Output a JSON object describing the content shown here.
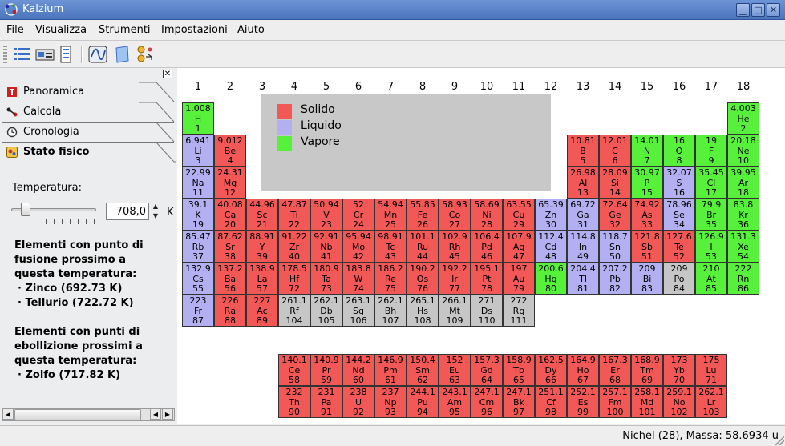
{
  "window": {
    "title": "Kalzium"
  },
  "menu": [
    "File",
    "Visualizza",
    "Strumenti",
    "Impostazioni",
    "Aiuto"
  ],
  "toolbar": {
    "icons": [
      "table-view-icon",
      "legend-icon",
      "element-list-icon",
      "plot-icon",
      "glossary-icon",
      "molecule-icon"
    ]
  },
  "sidebar": {
    "tabs": [
      {
        "label": "Panoramica",
        "icon": "overview-icon"
      },
      {
        "label": "Calcola",
        "icon": "calculator-icon"
      },
      {
        "label": "Cronologia",
        "icon": "clock-icon"
      },
      {
        "label": "Stato fisico",
        "icon": "state-of-matter-icon"
      }
    ],
    "temperature_label": "Temperatura:",
    "temperature_value": "708,0",
    "temperature_unit": "K",
    "slider_fraction": 0.13,
    "melting_heading": "Elementi con punto di fusione prossimo a questa temperatura:",
    "melting_elements": [
      "· Zinco (692.73 K)",
      "· Tellurio (722.72 K)"
    ],
    "boiling_heading": "Elementi con punti di ebollizione prossimi a questa temperatura:",
    "boiling_elements": [
      "· Zolfo (717.82 K)"
    ]
  },
  "groups": [
    "1",
    "2",
    "3",
    "4",
    "5",
    "6",
    "7",
    "8",
    "9",
    "10",
    "11",
    "12",
    "13",
    "14",
    "15",
    "16",
    "17",
    "18"
  ],
  "legend": [
    {
      "label": "Solido",
      "color": "#f25856"
    },
    {
      "label": "Liquido",
      "color": "#b3b0f1"
    },
    {
      "label": "Vapore",
      "color": "#57f13b"
    }
  ],
  "colors": {
    "solid": "#f25856",
    "liquid": "#b3b0f1",
    "vapor": "#57f13b",
    "unknown": "#c6c6c6"
  },
  "elements": [
    {
      "m": "1.008",
      "s": "H",
      "n": "1",
      "st": "vapor",
      "g": 1,
      "p": 1
    },
    {
      "m": "4.003",
      "s": "He",
      "n": "2",
      "st": "vapor",
      "g": 18,
      "p": 1
    },
    {
      "m": "6.941",
      "s": "Li",
      "n": "3",
      "st": "liquid",
      "g": 1,
      "p": 2
    },
    {
      "m": "9.012",
      "s": "Be",
      "n": "4",
      "st": "solid",
      "g": 2,
      "p": 2
    },
    {
      "m": "10.81",
      "s": "B",
      "n": "5",
      "st": "solid",
      "g": 13,
      "p": 2
    },
    {
      "m": "12.01",
      "s": "C",
      "n": "6",
      "st": "solid",
      "g": 14,
      "p": 2
    },
    {
      "m": "14.01",
      "s": "N",
      "n": "7",
      "st": "vapor",
      "g": 15,
      "p": 2
    },
    {
      "m": "16",
      "s": "O",
      "n": "8",
      "st": "vapor",
      "g": 16,
      "p": 2
    },
    {
      "m": "19",
      "s": "F",
      "n": "9",
      "st": "vapor",
      "g": 17,
      "p": 2
    },
    {
      "m": "20.18",
      "s": "Ne",
      "n": "10",
      "st": "vapor",
      "g": 18,
      "p": 2
    },
    {
      "m": "22.99",
      "s": "Na",
      "n": "11",
      "st": "liquid",
      "g": 1,
      "p": 3
    },
    {
      "m": "24.31",
      "s": "Mg",
      "n": "12",
      "st": "solid",
      "g": 2,
      "p": 3
    },
    {
      "m": "26.98",
      "s": "Al",
      "n": "13",
      "st": "solid",
      "g": 13,
      "p": 3
    },
    {
      "m": "28.09",
      "s": "Si",
      "n": "14",
      "st": "solid",
      "g": 14,
      "p": 3
    },
    {
      "m": "30.97",
      "s": "P",
      "n": "15",
      "st": "vapor",
      "g": 15,
      "p": 3
    },
    {
      "m": "32.07",
      "s": "S",
      "n": "16",
      "st": "liquid",
      "g": 16,
      "p": 3
    },
    {
      "m": "35.45",
      "s": "Cl",
      "n": "17",
      "st": "vapor",
      "g": 17,
      "p": 3
    },
    {
      "m": "39.95",
      "s": "Ar",
      "n": "18",
      "st": "vapor",
      "g": 18,
      "p": 3
    },
    {
      "m": "39.1",
      "s": "K",
      "n": "19",
      "st": "liquid",
      "g": 1,
      "p": 4
    },
    {
      "m": "40.08",
      "s": "Ca",
      "n": "20",
      "st": "solid",
      "g": 2,
      "p": 4
    },
    {
      "m": "44.96",
      "s": "Sc",
      "n": "21",
      "st": "solid",
      "g": 3,
      "p": 4
    },
    {
      "m": "47.87",
      "s": "Ti",
      "n": "22",
      "st": "solid",
      "g": 4,
      "p": 4
    },
    {
      "m": "50.94",
      "s": "V",
      "n": "23",
      "st": "solid",
      "g": 5,
      "p": 4
    },
    {
      "m": "52",
      "s": "Cr",
      "n": "24",
      "st": "solid",
      "g": 6,
      "p": 4
    },
    {
      "m": "54.94",
      "s": "Mn",
      "n": "25",
      "st": "solid",
      "g": 7,
      "p": 4
    },
    {
      "m": "55.85",
      "s": "Fe",
      "n": "26",
      "st": "solid",
      "g": 8,
      "p": 4
    },
    {
      "m": "58.93",
      "s": "Co",
      "n": "27",
      "st": "solid",
      "g": 9,
      "p": 4
    },
    {
      "m": "58.69",
      "s": "Ni",
      "n": "28",
      "st": "solid",
      "g": 10,
      "p": 4
    },
    {
      "m": "63.55",
      "s": "Cu",
      "n": "29",
      "st": "solid",
      "g": 11,
      "p": 4
    },
    {
      "m": "65.39",
      "s": "Zn",
      "n": "30",
      "st": "liquid",
      "g": 12,
      "p": 4
    },
    {
      "m": "69.72",
      "s": "Ga",
      "n": "31",
      "st": "liquid",
      "g": 13,
      "p": 4
    },
    {
      "m": "72.64",
      "s": "Ge",
      "n": "32",
      "st": "solid",
      "g": 14,
      "p": 4
    },
    {
      "m": "74.92",
      "s": "As",
      "n": "33",
      "st": "solid",
      "g": 15,
      "p": 4
    },
    {
      "m": "78.96",
      "s": "Se",
      "n": "34",
      "st": "liquid",
      "g": 16,
      "p": 4
    },
    {
      "m": "79.9",
      "s": "Br",
      "n": "35",
      "st": "vapor",
      "g": 17,
      "p": 4
    },
    {
      "m": "83.8",
      "s": "Kr",
      "n": "36",
      "st": "vapor",
      "g": 18,
      "p": 4
    },
    {
      "m": "85.47",
      "s": "Rb",
      "n": "37",
      "st": "liquid",
      "g": 1,
      "p": 5
    },
    {
      "m": "87.62",
      "s": "Sr",
      "n": "38",
      "st": "solid",
      "g": 2,
      "p": 5
    },
    {
      "m": "88.91",
      "s": "Y",
      "n": "39",
      "st": "solid",
      "g": 3,
      "p": 5
    },
    {
      "m": "91.22",
      "s": "Zr",
      "n": "40",
      "st": "solid",
      "g": 4,
      "p": 5
    },
    {
      "m": "92.91",
      "s": "Nb",
      "n": "41",
      "st": "solid",
      "g": 5,
      "p": 5
    },
    {
      "m": "95.94",
      "s": "Mo",
      "n": "42",
      "st": "solid",
      "g": 6,
      "p": 5
    },
    {
      "m": "98.91",
      "s": "Tc",
      "n": "43",
      "st": "solid",
      "g": 7,
      "p": 5
    },
    {
      "m": "101.1",
      "s": "Ru",
      "n": "44",
      "st": "solid",
      "g": 8,
      "p": 5
    },
    {
      "m": "102.9",
      "s": "Rh",
      "n": "45",
      "st": "solid",
      "g": 9,
      "p": 5
    },
    {
      "m": "106.4",
      "s": "Pd",
      "n": "46",
      "st": "solid",
      "g": 10,
      "p": 5
    },
    {
      "m": "107.9",
      "s": "Ag",
      "n": "47",
      "st": "solid",
      "g": 11,
      "p": 5
    },
    {
      "m": "112.4",
      "s": "Cd",
      "n": "48",
      "st": "liquid",
      "g": 12,
      "p": 5
    },
    {
      "m": "114.8",
      "s": "In",
      "n": "49",
      "st": "liquid",
      "g": 13,
      "p": 5
    },
    {
      "m": "118.7",
      "s": "Sn",
      "n": "50",
      "st": "liquid",
      "g": 14,
      "p": 5
    },
    {
      "m": "121.8",
      "s": "Sb",
      "n": "51",
      "st": "solid",
      "g": 15,
      "p": 5
    },
    {
      "m": "127.6",
      "s": "Te",
      "n": "52",
      "st": "solid",
      "g": 16,
      "p": 5
    },
    {
      "m": "126.9",
      "s": "I",
      "n": "53",
      "st": "vapor",
      "g": 17,
      "p": 5
    },
    {
      "m": "131.3",
      "s": "Xe",
      "n": "54",
      "st": "vapor",
      "g": 18,
      "p": 5
    },
    {
      "m": "132.9",
      "s": "Cs",
      "n": "55",
      "st": "liquid",
      "g": 1,
      "p": 6
    },
    {
      "m": "137.2",
      "s": "Ba",
      "n": "56",
      "st": "solid",
      "g": 2,
      "p": 6
    },
    {
      "m": "138.9",
      "s": "La",
      "n": "57",
      "st": "solid",
      "g": 3,
      "p": 6
    },
    {
      "m": "178.5",
      "s": "Hf",
      "n": "72",
      "st": "solid",
      "g": 4,
      "p": 6
    },
    {
      "m": "180.9",
      "s": "Ta",
      "n": "73",
      "st": "solid",
      "g": 5,
      "p": 6
    },
    {
      "m": "183.8",
      "s": "W",
      "n": "74",
      "st": "solid",
      "g": 6,
      "p": 6
    },
    {
      "m": "186.2",
      "s": "Re",
      "n": "75",
      "st": "solid",
      "g": 7,
      "p": 6
    },
    {
      "m": "190.2",
      "s": "Os",
      "n": "76",
      "st": "solid",
      "g": 8,
      "p": 6
    },
    {
      "m": "192.2",
      "s": "Ir",
      "n": "77",
      "st": "solid",
      "g": 9,
      "p": 6
    },
    {
      "m": "195.1",
      "s": "Pt",
      "n": "78",
      "st": "solid",
      "g": 10,
      "p": 6
    },
    {
      "m": "197",
      "s": "Au",
      "n": "79",
      "st": "solid",
      "g": 11,
      "p": 6
    },
    {
      "m": "200.6",
      "s": "Hg",
      "n": "80",
      "st": "vapor",
      "g": 12,
      "p": 6
    },
    {
      "m": "204.4",
      "s": "Tl",
      "n": "81",
      "st": "liquid",
      "g": 13,
      "p": 6
    },
    {
      "m": "207.2",
      "s": "Pb",
      "n": "82",
      "st": "liquid",
      "g": 14,
      "p": 6
    },
    {
      "m": "209",
      "s": "Bi",
      "n": "83",
      "st": "liquid",
      "g": 15,
      "p": 6
    },
    {
      "m": "209",
      "s": "Po",
      "n": "84",
      "st": "unknown",
      "g": 16,
      "p": 6
    },
    {
      "m": "210",
      "s": "At",
      "n": "85",
      "st": "vapor",
      "g": 17,
      "p": 6
    },
    {
      "m": "222",
      "s": "Rn",
      "n": "86",
      "st": "vapor",
      "g": 18,
      "p": 6
    },
    {
      "m": "223",
      "s": "Fr",
      "n": "87",
      "st": "liquid",
      "g": 1,
      "p": 7
    },
    {
      "m": "226",
      "s": "Ra",
      "n": "88",
      "st": "solid",
      "g": 2,
      "p": 7
    },
    {
      "m": "227",
      "s": "Ac",
      "n": "89",
      "st": "solid",
      "g": 3,
      "p": 7
    },
    {
      "m": "261.1",
      "s": "Rf",
      "n": "104",
      "st": "unknown",
      "g": 4,
      "p": 7
    },
    {
      "m": "262.1",
      "s": "Db",
      "n": "105",
      "st": "unknown",
      "g": 5,
      "p": 7
    },
    {
      "m": "263.1",
      "s": "Sg",
      "n": "106",
      "st": "unknown",
      "g": 6,
      "p": 7
    },
    {
      "m": "262.1",
      "s": "Bh",
      "n": "107",
      "st": "unknown",
      "g": 7,
      "p": 7
    },
    {
      "m": "265.1",
      "s": "Hs",
      "n": "108",
      "st": "unknown",
      "g": 8,
      "p": 7
    },
    {
      "m": "266.1",
      "s": "Mt",
      "n": "109",
      "st": "unknown",
      "g": 9,
      "p": 7
    },
    {
      "m": "271",
      "s": "Ds",
      "n": "110",
      "st": "unknown",
      "g": 10,
      "p": 7
    },
    {
      "m": "272",
      "s": "Rg",
      "n": "111",
      "st": "unknown",
      "g": 11,
      "p": 7
    },
    {
      "m": "140.1",
      "s": "Ce",
      "n": "58",
      "st": "solid",
      "g": 4,
      "p": 9
    },
    {
      "m": "140.9",
      "s": "Pr",
      "n": "59",
      "st": "solid",
      "g": 5,
      "p": 9
    },
    {
      "m": "144.2",
      "s": "Nd",
      "n": "60",
      "st": "solid",
      "g": 6,
      "p": 9
    },
    {
      "m": "146.9",
      "s": "Pm",
      "n": "61",
      "st": "solid",
      "g": 7,
      "p": 9
    },
    {
      "m": "150.4",
      "s": "Sm",
      "n": "62",
      "st": "solid",
      "g": 8,
      "p": 9
    },
    {
      "m": "152",
      "s": "Eu",
      "n": "63",
      "st": "solid",
      "g": 9,
      "p": 9
    },
    {
      "m": "157.3",
      "s": "Gd",
      "n": "64",
      "st": "solid",
      "g": 10,
      "p": 9
    },
    {
      "m": "158.9",
      "s": "Tb",
      "n": "65",
      "st": "solid",
      "g": 11,
      "p": 9
    },
    {
      "m": "162.5",
      "s": "Dy",
      "n": "66",
      "st": "solid",
      "g": 12,
      "p": 9
    },
    {
      "m": "164.9",
      "s": "Ho",
      "n": "67",
      "st": "solid",
      "g": 13,
      "p": 9
    },
    {
      "m": "167.3",
      "s": "Er",
      "n": "68",
      "st": "solid",
      "g": 14,
      "p": 9
    },
    {
      "m": "168.9",
      "s": "Tm",
      "n": "69",
      "st": "solid",
      "g": 15,
      "p": 9
    },
    {
      "m": "173",
      "s": "Yb",
      "n": "70",
      "st": "solid",
      "g": 16,
      "p": 9
    },
    {
      "m": "175",
      "s": "Lu",
      "n": "71",
      "st": "solid",
      "g": 17,
      "p": 9
    },
    {
      "m": "232",
      "s": "Th",
      "n": "90",
      "st": "solid",
      "g": 4,
      "p": 10
    },
    {
      "m": "231",
      "s": "Pa",
      "n": "91",
      "st": "solid",
      "g": 5,
      "p": 10
    },
    {
      "m": "238",
      "s": "U",
      "n": "92",
      "st": "solid",
      "g": 6,
      "p": 10
    },
    {
      "m": "237",
      "s": "Np",
      "n": "93",
      "st": "solid",
      "g": 7,
      "p": 10
    },
    {
      "m": "244.1",
      "s": "Pu",
      "n": "94",
      "st": "solid",
      "g": 8,
      "p": 10
    },
    {
      "m": "243.1",
      "s": "Am",
      "n": "95",
      "st": "solid",
      "g": 9,
      "p": 10
    },
    {
      "m": "247.1",
      "s": "Cm",
      "n": "96",
      "st": "solid",
      "g": 10,
      "p": 10
    },
    {
      "m": "247.1",
      "s": "Bk",
      "n": "97",
      "st": "solid",
      "g": 11,
      "p": 10
    },
    {
      "m": "251.1",
      "s": "Cf",
      "n": "98",
      "st": "solid",
      "g": 12,
      "p": 10
    },
    {
      "m": "252.1",
      "s": "Es",
      "n": "99",
      "st": "solid",
      "g": 13,
      "p": 10
    },
    {
      "m": "257.1",
      "s": "Fm",
      "n": "100",
      "st": "solid",
      "g": 14,
      "p": 10
    },
    {
      "m": "258.1",
      "s": "Md",
      "n": "101",
      "st": "solid",
      "g": 15,
      "p": 10
    },
    {
      "m": "259.1",
      "s": "No",
      "n": "102",
      "st": "solid",
      "g": 16,
      "p": 10
    },
    {
      "m": "262.1",
      "s": "Lr",
      "n": "103",
      "st": "solid",
      "g": 17,
      "p": 10
    }
  ],
  "status": "Nichel (28), Massa: 58.6934 u"
}
